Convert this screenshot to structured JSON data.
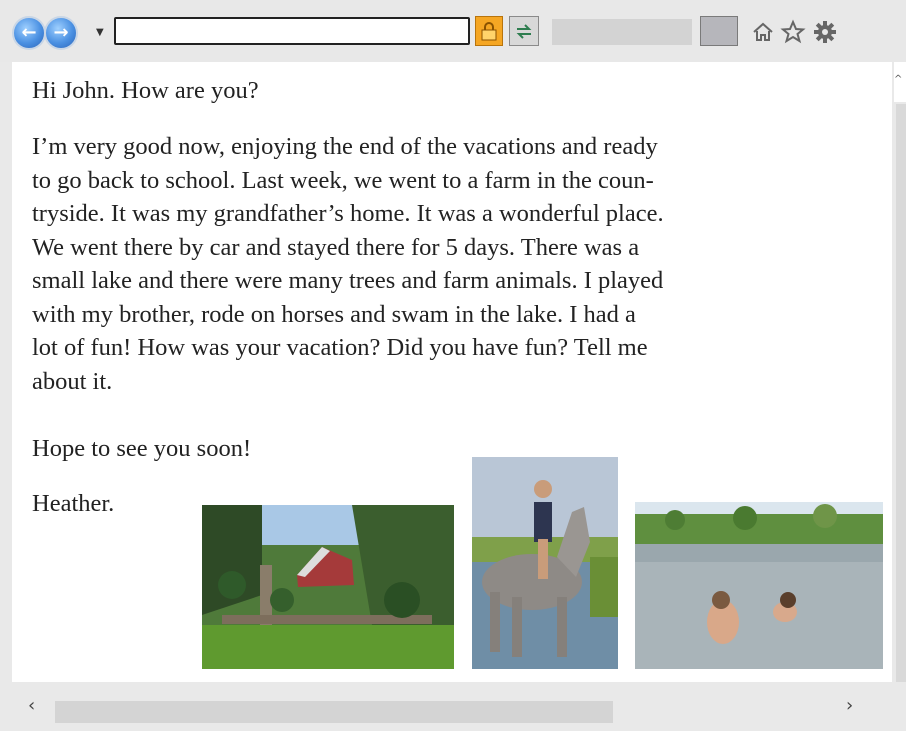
{
  "browser": {
    "back_icon": "back-arrow-icon",
    "forward_icon": "forward-arrow-icon",
    "address_value": "",
    "icons": [
      "dropdown-icon",
      "lock-icon",
      "refresh-icon",
      "home-icon",
      "star-icon",
      "gear-icon"
    ],
    "colors": {
      "nav_button": "#4a90e2",
      "lock": "#f5a623"
    }
  },
  "letter": {
    "greeting": "Hi John. How are you?",
    "lines": [
      "I’m very good now, enjoying the end of the vacations and ready",
      "to go back to school. Last week, we went to a farm in the coun-",
      "tryside. It was my grandfather’s home. It was a wonderful place.",
      "We went there by car and stayed there for 5 days. There was a",
      "small lake and there were many trees and farm animals. I played",
      "with my brother, rode on horses and swam in the lake. I had a",
      "lot of fun! How was your vacation? Did you have fun? Tell me",
      "about it."
    ],
    "closing": "Hope to see you soon!",
    "signature": "Heather."
  },
  "photos": [
    "farm-barn-photo",
    "girl-on-horse-photo",
    "children-swimming-photo"
  ],
  "scrollbar": {
    "left_arrow": "‹",
    "right_arrow": "›",
    "up_arrow": "^"
  }
}
